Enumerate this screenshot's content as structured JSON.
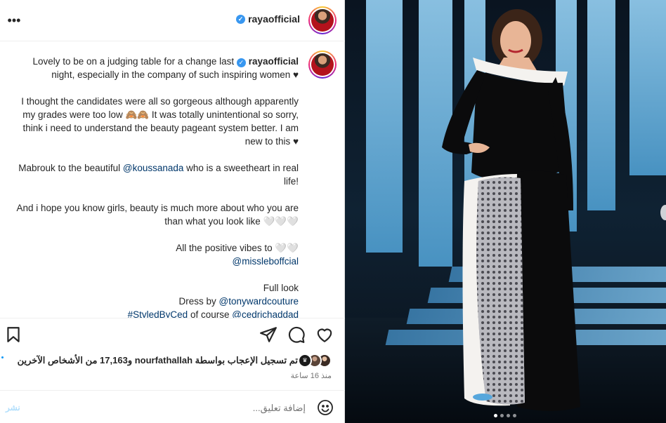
{
  "header": {
    "username": "rayaofficial",
    "more_label": "•••"
  },
  "caption": {
    "username": "rayaofficial",
    "line1": "Lovely to be on a judging table for a change last",
    "line1b": "night, especially in the company of such inspiring women ♥",
    "para2": "I thought the candidates were all so gorgeous although apparently my grades were too low 🙈🙈 It was totally unintentional so sorry, think i need to understand the beauty pageant system better. I am new to this ♥",
    "para3_pre": "Mabrouk to the beautiful",
    "para3_mention": "@koussanada",
    "para3_post": "who is a sweetheart in real life!",
    "para4": "And i hope you know girls, beauty is much more about who you are than what you look like 🤍🤍🤍",
    "para5_text": "All the positive vibes to 🤍🤍",
    "para5_mention": "@missleboffcial",
    "full_look": "Full look",
    "dress_by": "Dress by",
    "dress_mention": "@tonywardcouture",
    "styled_tag": "#StyledByCed",
    "of_course": "of course",
    "ced_mention": "@cedrichaddad"
  },
  "likes": {
    "text": "تم تسجيل الإعجاب بواسطة nourfathallah و17,163 من الأشخاص الآخرين"
  },
  "timeago": "منذ 16 ساعة",
  "comment": {
    "placeholder": "إضافة تعليق...",
    "post_label": "نشر"
  },
  "icons": {
    "more": "more-horizontal-icon",
    "verified": "verified-badge-icon",
    "bookmark": "bookmark-icon",
    "share": "share-icon",
    "comment": "comment-icon",
    "heart": "heart-icon",
    "emoji": "emoji-icon"
  },
  "colors": {
    "link": "#00376b",
    "verified": "#3897f0",
    "muted": "#737373",
    "post_disabled": "#b2dffc"
  },
  "carousel": {
    "count": 4,
    "active_index": 1
  }
}
